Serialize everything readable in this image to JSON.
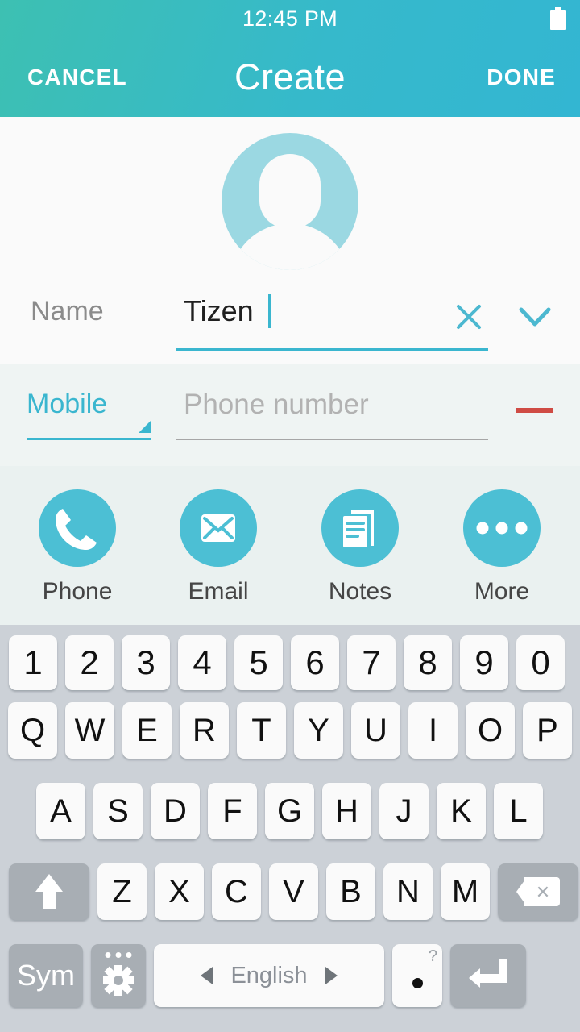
{
  "statusbar": {
    "time": "12:45 PM",
    "battery_icon": "battery-full-icon"
  },
  "header": {
    "cancel_label": "CANCEL",
    "title": "Create",
    "done_label": "DONE",
    "gradient_from": "#3dc0b2",
    "gradient_to": "#33b6d2"
  },
  "contact": {
    "avatar_icon": "default-contact-avatar-icon",
    "name": {
      "label": "Name",
      "value": "Tizen",
      "clear_icon": "clear-x-icon",
      "expand_icon": "chevron-down-icon",
      "accent": "#3ab6cf"
    },
    "phone": {
      "type_label": "Mobile",
      "type_caret_icon": "dropdown-caret-icon",
      "placeholder": "Phone number",
      "value": "",
      "remove_icon": "remove-minus-icon",
      "remove_color": "#cf4b44"
    }
  },
  "actions": {
    "accent": "#4cbfd4",
    "items": [
      {
        "label": "Phone",
        "icon": "phone-handset-icon"
      },
      {
        "label": "Email",
        "icon": "envelope-icon"
      },
      {
        "label": "Notes",
        "icon": "notes-document-icon"
      },
      {
        "label": "More",
        "icon": "more-dots-icon"
      }
    ]
  },
  "keyboard": {
    "rows": {
      "numbers": [
        "1",
        "2",
        "3",
        "4",
        "5",
        "6",
        "7",
        "8",
        "9",
        "0"
      ],
      "qwerty": [
        "Q",
        "W",
        "E",
        "R",
        "T",
        "Y",
        "U",
        "I",
        "O",
        "P"
      ],
      "asdf": [
        "A",
        "S",
        "D",
        "F",
        "G",
        "H",
        "J",
        "K",
        "L"
      ],
      "zxcv": [
        "Z",
        "X",
        "C",
        "V",
        "B",
        "N",
        "M"
      ]
    },
    "shift_icon": "shift-arrow-up-icon",
    "backspace_icon": "backspace-icon",
    "sym_label": "Sym",
    "settings_icon": "keyboard-settings-gear-icon",
    "space_language": "English",
    "space_prev_icon": "prev-language-arrow-icon",
    "space_next_icon": "next-language-arrow-icon",
    "period_label": ".",
    "period_hint": "?",
    "enter_icon": "enter-return-icon"
  }
}
